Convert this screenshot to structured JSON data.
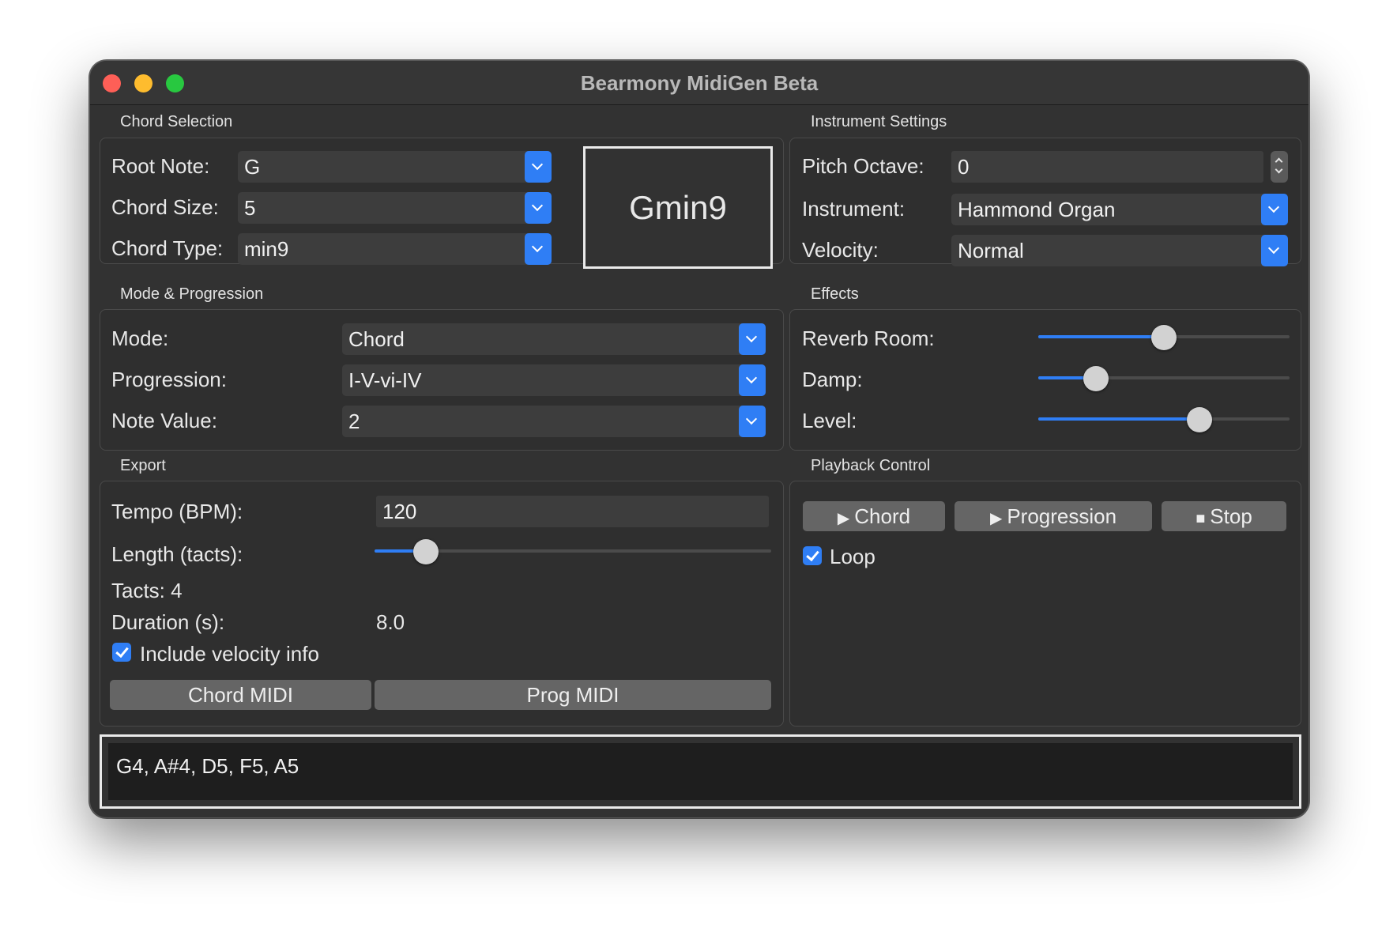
{
  "window": {
    "title": "Bearmony MidiGen Beta"
  },
  "chord_selection": {
    "title": "Chord Selection",
    "root_label": "Root Note:",
    "root_value": "G",
    "size_label": "Chord Size:",
    "size_value": "5",
    "type_label": "Chord Type:",
    "type_value": "min9",
    "display": "Gmin9"
  },
  "instrument_settings": {
    "title": "Instrument Settings",
    "pitch_label": "Pitch Octave:",
    "pitch_value": "0",
    "instrument_label": "Instrument:",
    "instrument_value": "Hammond Organ",
    "velocity_label": "Velocity:",
    "velocity_value": "Normal"
  },
  "mode_progression": {
    "title": "Mode & Progression",
    "mode_label": "Mode:",
    "mode_value": "Chord",
    "progression_label": "Progression:",
    "progression_value": "I-V-vi-IV",
    "note_label": "Note Value:",
    "note_value": "2"
  },
  "effects": {
    "title": "Effects",
    "reverb_label": "Reverb Room:",
    "reverb_level": 0.5,
    "damp_label": "Damp:",
    "damp_level": 0.23,
    "level_label": "Level:",
    "level_level": 0.64
  },
  "export": {
    "title": "Export",
    "tempo_label": "Tempo (BPM):",
    "tempo_value": "120",
    "length_label": "Length (tacts):",
    "length_level": 0.13,
    "tacts_text": "Tacts: 4",
    "duration_label": "Duration (s):",
    "duration_value": "8.0",
    "velocity_info_label": "Include velocity info",
    "chord_midi_label": "Chord MIDI",
    "prog_midi_label": "Prog MIDI"
  },
  "playback": {
    "title": "Playback Control",
    "chord_button": "Chord",
    "progression_button": "Progression",
    "stop_button": "Stop",
    "play_glyph": "▶",
    "stop_glyph": "■",
    "loop_label": "Loop"
  },
  "output": {
    "notes": "G4, A#4, D5, F5, A5"
  },
  "colors": {
    "accent": "#2f7ef5",
    "background": "#323232",
    "control": "#3d3d3d"
  }
}
